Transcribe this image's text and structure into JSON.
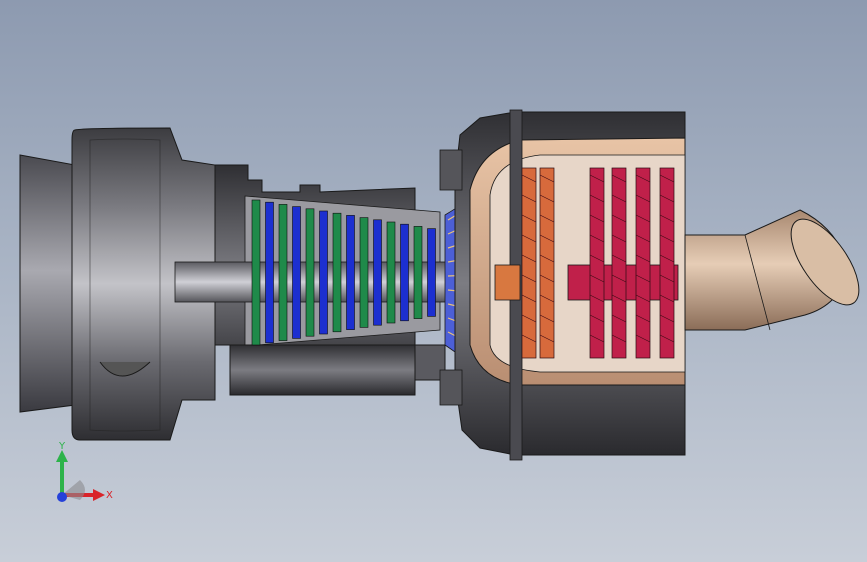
{
  "viewport": {
    "background_top": "#8d9ab0",
    "background_bottom": "#c8ced8"
  },
  "model": {
    "description_icon": "turbojet-engine-section-view",
    "colors": {
      "casing_dark": "#3a3a3e",
      "casing_mid": "#6b6b70",
      "casing_light": "#b9b9bf",
      "compressor_green": "#1f8a4a",
      "compressor_blue": "#1c2fd0",
      "combustor_copper": "#c0704a",
      "turbine_orange": "#d76a3c",
      "turbine_red": "#c0204a",
      "nozzle_tan": "#c9a88d"
    }
  },
  "triad": {
    "x_label": "X",
    "y_label": "Y",
    "x_color": "#d9232a",
    "y_color": "#2db34a",
    "z_color": "#2541d9"
  }
}
